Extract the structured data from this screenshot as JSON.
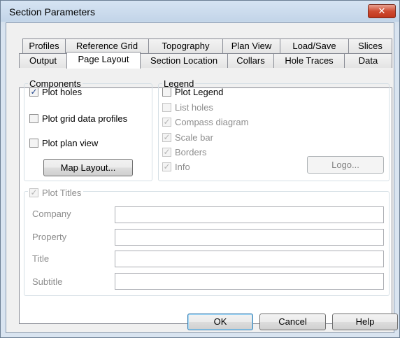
{
  "window": {
    "title": "Section Parameters"
  },
  "tabs_row1": [
    {
      "label": "Profiles"
    },
    {
      "label": "Reference Grid"
    },
    {
      "label": "Topography"
    },
    {
      "label": "Plan View"
    },
    {
      "label": "Load/Save"
    },
    {
      "label": "Slices"
    }
  ],
  "tabs_row2": [
    {
      "label": "Output"
    },
    {
      "label": "Page Layout",
      "selected": true
    },
    {
      "label": "Section Location"
    },
    {
      "label": "Collars"
    },
    {
      "label": "Hole Traces"
    },
    {
      "label": "Data"
    }
  ],
  "components": {
    "legend": "Components",
    "items": [
      {
        "label": "Plot holes",
        "checked": true
      },
      {
        "label": "Plot grid data profiles",
        "checked": false
      },
      {
        "label": "Plot plan view",
        "checked": false
      }
    ],
    "map_layout_button": "Map Layout..."
  },
  "legend_group": {
    "legend": "Legend",
    "items": [
      {
        "label": "Plot Legend",
        "checked": false,
        "enabled": true
      },
      {
        "label": "List holes",
        "checked": false,
        "enabled": false
      },
      {
        "label": "Compass diagram",
        "checked": true,
        "enabled": false
      },
      {
        "label": "Scale bar",
        "checked": true,
        "enabled": false
      },
      {
        "label": "Borders",
        "checked": true,
        "enabled": false
      },
      {
        "label": "Info",
        "checked": true,
        "enabled": false
      }
    ],
    "logo_button": "Logo..."
  },
  "plot_titles": {
    "label": "Plot Titles",
    "checked": true,
    "enabled": false,
    "fields": [
      {
        "label": "Company",
        "value": ""
      },
      {
        "label": "Property",
        "value": ""
      },
      {
        "label": "Title",
        "value": ""
      },
      {
        "label": "Subtitle",
        "value": ""
      }
    ]
  },
  "footer": {
    "ok": "OK",
    "cancel": "Cancel",
    "help": "Help"
  },
  "icons": {
    "close": "close-icon",
    "check": "checkmark-icon"
  }
}
